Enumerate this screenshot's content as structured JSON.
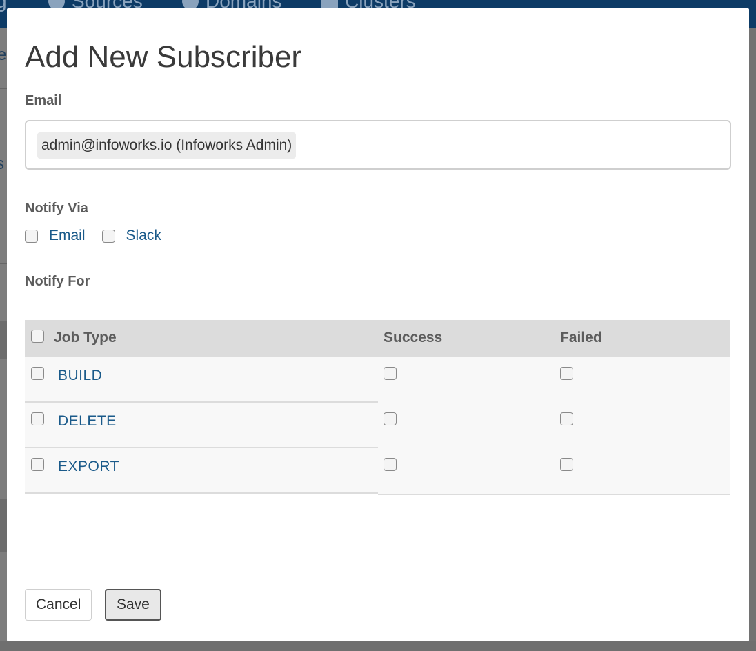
{
  "background": {
    "nav": [
      "g",
      "Sources",
      "Domains",
      "Clusters"
    ],
    "left_fragments": [
      "e",
      "s"
    ]
  },
  "modal": {
    "title": "Add New Subscriber",
    "email_label": "Email",
    "email_chip": "admin@infoworks.io (Infoworks Admin)",
    "notify_via_label": "Notify Via",
    "notify_via_options": [
      "Email",
      "Slack"
    ],
    "notify_for_label": "Notify For",
    "table": {
      "headers": [
        "Job Type",
        "Success",
        "Failed"
      ],
      "rows": [
        "BUILD",
        "DELETE",
        "EXPORT"
      ]
    },
    "cancel_label": "Cancel",
    "save_label": "Save"
  },
  "colors": {
    "topbar": "#0d3b66",
    "link": "#1a5a8a",
    "table_header": "#dcdcdc"
  }
}
